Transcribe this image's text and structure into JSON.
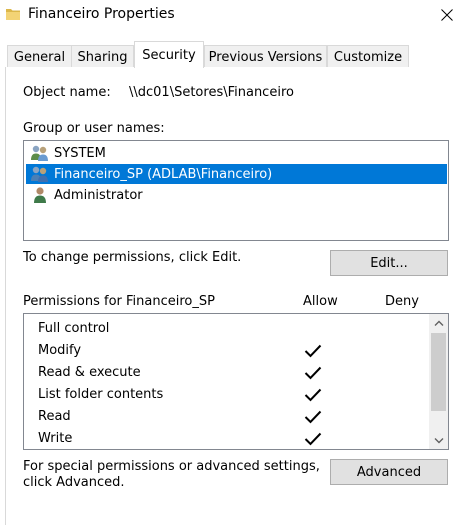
{
  "window": {
    "title": "Financeiro Properties",
    "icon": "folder-icon",
    "close_icon": "close-icon"
  },
  "tabs": [
    {
      "label": "General",
      "active": false
    },
    {
      "label": "Sharing",
      "active": false
    },
    {
      "label": "Security",
      "active": true
    },
    {
      "label": "Previous Versions",
      "active": false
    },
    {
      "label": "Customize",
      "active": false
    }
  ],
  "security": {
    "object_name_label": "Object name:",
    "object_name_value": "\\\\dc01\\Setores\\Financeiro",
    "group_label": "Group or user names:",
    "users": [
      {
        "name": "SYSTEM",
        "icon": "users-group-icon",
        "selected": false
      },
      {
        "name": "Financeiro_SP (ADLAB\\Financeiro)",
        "icon": "users-group-icon",
        "selected": true
      },
      {
        "name": "Administrator",
        "icon": "user-icon",
        "selected": false
      }
    ],
    "change_hint": "To change permissions, click Edit.",
    "edit_button": "Edit...",
    "permissions_label": "Permissions for Financeiro_SP",
    "allow_header": "Allow",
    "deny_header": "Deny",
    "permissions": [
      {
        "name": "Full control",
        "allow": false,
        "deny": false
      },
      {
        "name": "Modify",
        "allow": true,
        "deny": false
      },
      {
        "name": "Read & execute",
        "allow": true,
        "deny": false
      },
      {
        "name": "List folder contents",
        "allow": true,
        "deny": false
      },
      {
        "name": "Read",
        "allow": true,
        "deny": false
      },
      {
        "name": "Write",
        "allow": true,
        "deny": false
      }
    ],
    "special_line1": "For special permissions or advanced settings,",
    "special_line2": "click Advanced.",
    "advanced_button": "Advanced"
  },
  "colors": {
    "selection": "#0078d7",
    "button_bg": "#e1e1e1",
    "border": "#828790"
  }
}
